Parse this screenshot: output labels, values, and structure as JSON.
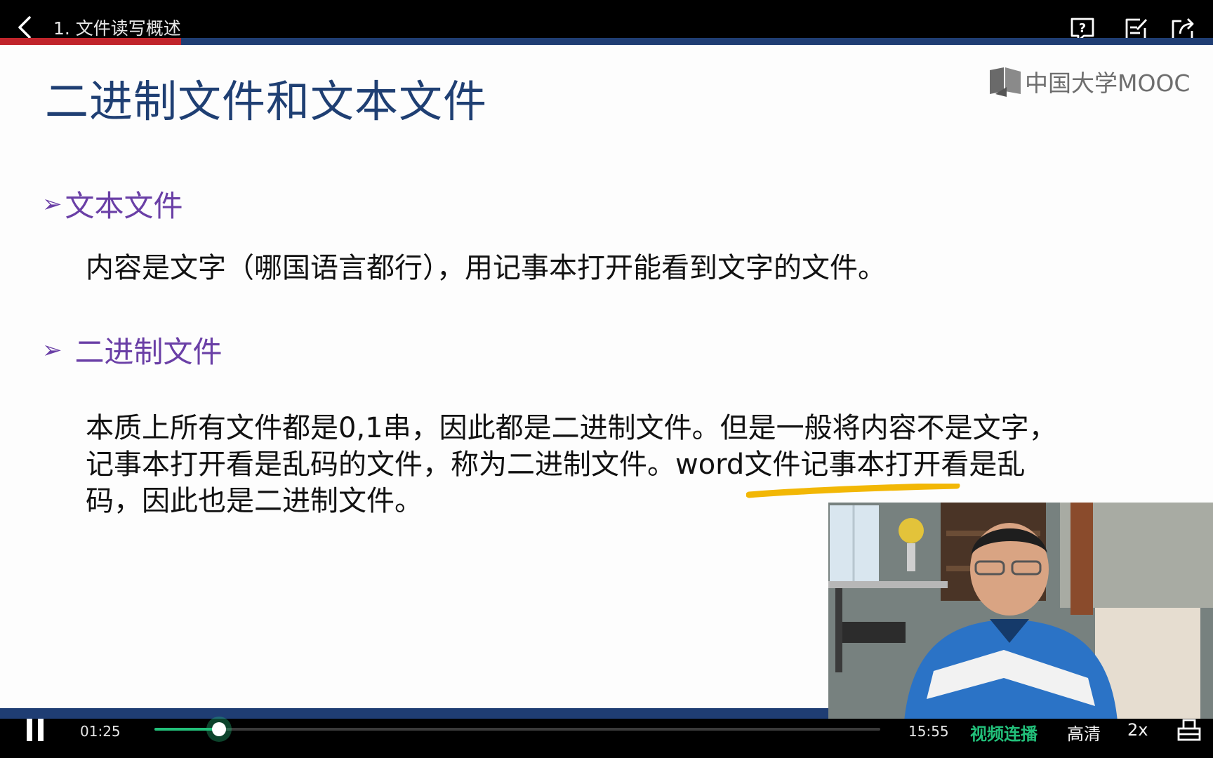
{
  "topbar": {
    "title": "1. 文件读写概述",
    "icons": [
      "back-icon",
      "question-icon",
      "note-icon",
      "share-icon"
    ]
  },
  "slide": {
    "title": "二进制文件和文本文件",
    "logo_text": "中国大学MOOC",
    "bullets": [
      {
        "label": "文本文件",
        "paragraph": "内容是文字（哪国语言都行），用记事本打开能看到文字的文件。"
      },
      {
        "label": "二进制文件",
        "paragraph_lines": [
          "本质上所有文件都是0,1串，因此都是二进制文件。但是一般将内容不是文字，",
          "记事本打开看是乱码的文件，称为二进制文件。word文件记事本打开看是乱",
          "码，因此也是二进制文件。"
        ]
      }
    ],
    "colors": {
      "title": "#1f3f73",
      "bullet": "#6a3fa6",
      "band": "#1f3d73",
      "accent_red": "#c0242b",
      "highlight": "#f2b705"
    }
  },
  "player": {
    "current_time": "01:25",
    "total_time": "15:55",
    "progress_fraction": 0.089,
    "autoplay_label": "视频连播",
    "quality_label": "高清",
    "speed_label": "2x",
    "accent": "#22c07a"
  }
}
